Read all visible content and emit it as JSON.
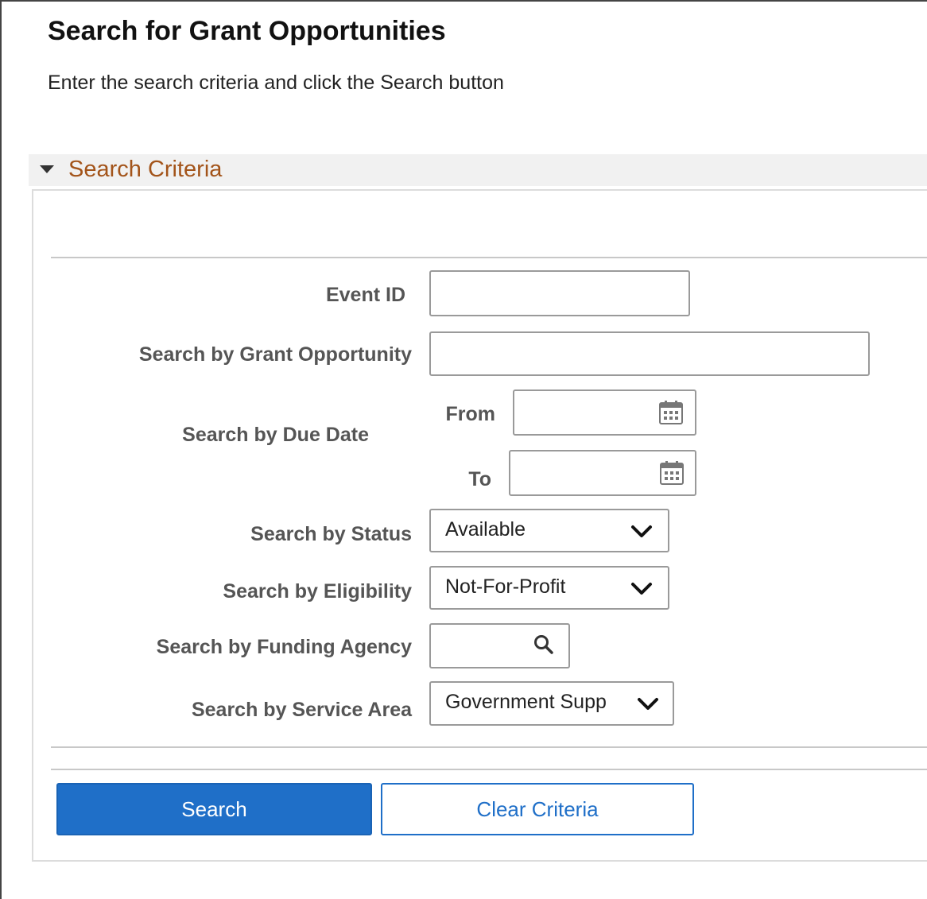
{
  "page": {
    "title": "Search for Grant Opportunities",
    "instructions": "Enter the search criteria and click the Search button"
  },
  "section": {
    "title": "Search Criteria"
  },
  "fields": {
    "event_id": {
      "label": "Event ID",
      "value": ""
    },
    "grant_opportunity": {
      "label": "Search by Grant Opportunity",
      "value": ""
    },
    "due_date": {
      "label": "Search by Due Date",
      "from_label": "From",
      "to_label": "To",
      "from_value": "",
      "to_value": "",
      "icon": "calendar-icon"
    },
    "status": {
      "label": "Search by Status",
      "value": "Available"
    },
    "eligibility": {
      "label": "Search by Eligibility",
      "value": "Not-For-Profit"
    },
    "funding_agency": {
      "label": "Search by Funding Agency",
      "value": "",
      "icon": "search-icon"
    },
    "service_area": {
      "label": "Search by Service Area",
      "value": "Government Supp"
    }
  },
  "buttons": {
    "search": "Search",
    "clear": "Clear Criteria"
  },
  "colors": {
    "section_title": "#a3541a",
    "primary": "#1f6fc8",
    "label": "#555555"
  }
}
